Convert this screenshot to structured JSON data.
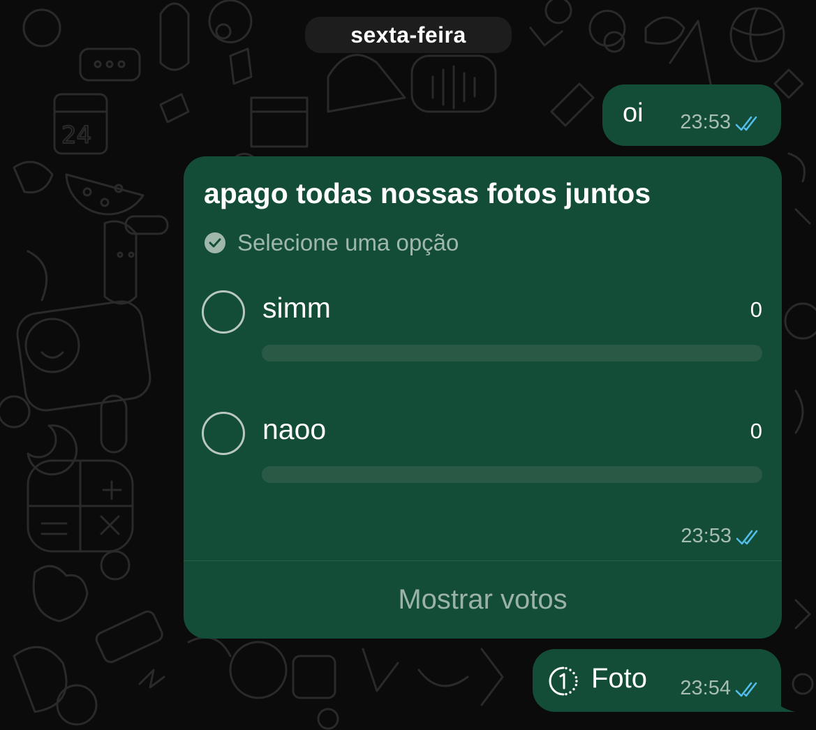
{
  "date_chip": "sexta-feira",
  "messages": [
    {
      "text": "oi",
      "time": "23:53",
      "status": "read-double-check-icon"
    }
  ],
  "poll": {
    "question": "apago todas nossas fotos juntos",
    "subtitle": "Selecione uma opção",
    "options": [
      {
        "label": "simm",
        "count": "0",
        "fraction": 0
      },
      {
        "label": "naoo",
        "count": "0",
        "fraction": 0
      }
    ],
    "time": "23:53",
    "show_votes_label": "Mostrar votos"
  },
  "photo_message": {
    "label": "Foto",
    "time": "23:54",
    "icon": "view-once-icon"
  },
  "colors": {
    "background": "#0b0b0b",
    "bubble_outgoing": "#134d37",
    "read_ticks": "#53bdeb",
    "meta_text": "#a7bdb2"
  }
}
